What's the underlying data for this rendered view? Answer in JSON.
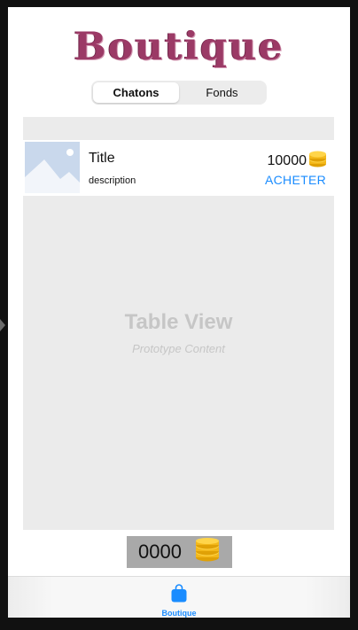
{
  "header": {
    "title": "Boutique"
  },
  "segmented_control": {
    "options": [
      {
        "label": "Chatons",
        "selected": true
      },
      {
        "label": "Fonds",
        "selected": false
      }
    ]
  },
  "table": {
    "cell": {
      "title": "Title",
      "description": "description",
      "price": "10000",
      "buy_label": "ACHETER"
    },
    "placeholder_title": "Table View",
    "placeholder_subtitle": "Prototype Content"
  },
  "balance": {
    "value": "0000"
  },
  "tab_bar": {
    "items": [
      {
        "label": "Boutique",
        "icon": "shopping-bag-icon",
        "selected": true
      }
    ]
  },
  "colors": {
    "accent": "#1a8cff",
    "title": "#9b3a66",
    "table_bg": "#ebebeb",
    "balance_bg": "#a9a9a9"
  }
}
